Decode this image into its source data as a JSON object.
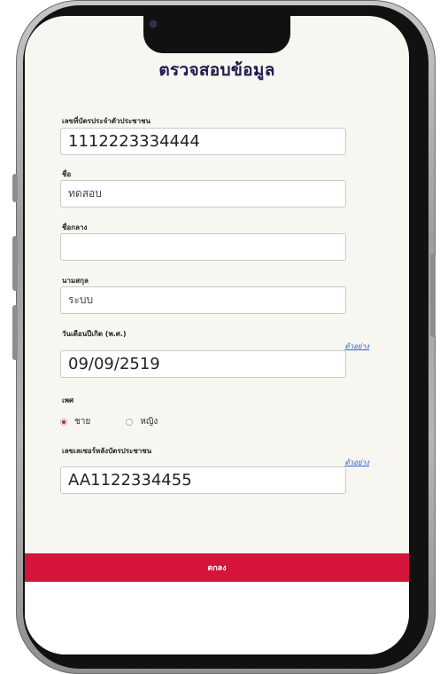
{
  "page": {
    "title": "ตรวจสอบข้อมูล"
  },
  "form": {
    "id_card_label": "เลขที่บัตรประจำตัวประชาชน",
    "id_card_value": "1112223334444",
    "first_name_label": "ชื่อ",
    "first_name_value": "ทดสอบ",
    "middle_name_label": "ชื่อกลาง",
    "middle_name_value": "",
    "last_name_label": "นามสกุล",
    "last_name_value": "ระบบ",
    "birthdate_label": "วันเดือนปีเกิด (พ.ศ.)",
    "birthdate_example_link": "ตัวอย่าง",
    "birthdate_value": "09/09/2519",
    "gender_label": "เพศ",
    "gender_options": [
      "ชาย",
      "หญิง"
    ],
    "gender_selected": "ชาย",
    "laser_code_label": "เลขเลเซอร์หลังบัตรประชาชน",
    "laser_code_example_link": "ตัวอย่าง",
    "laser_code_value": "AA1122334455",
    "submit_label": "ตกลง"
  },
  "colors": {
    "accent": "#d4143b",
    "title": "#1c1c4e",
    "link": "#2a63c9",
    "screen_bg": "#f8f6f1"
  }
}
